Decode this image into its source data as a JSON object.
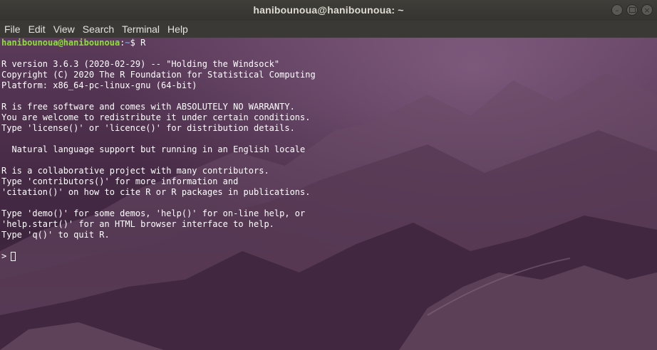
{
  "window": {
    "title": "hanibounoua@hanibounoua: ~"
  },
  "menu": [
    "File",
    "Edit",
    "View",
    "Search",
    "Terminal",
    "Help"
  ],
  "terminal": {
    "prompt": {
      "user_host": "hanibounoua@hanibounoua",
      "separator": ":",
      "path": "~",
      "symbol": "$ ",
      "command": "R"
    },
    "lines": [
      "",
      "R version 3.6.3 (2020-02-29) -- \"Holding the Windsock\"",
      "Copyright (C) 2020 The R Foundation for Statistical Computing",
      "Platform: x86_64-pc-linux-gnu (64-bit)",
      "",
      "R is free software and comes with ABSOLUTELY NO WARRANTY.",
      "You are welcome to redistribute it under certain conditions.",
      "Type 'license()' or 'licence()' for distribution details.",
      "",
      "  Natural language support but running in an English locale",
      "",
      "R is a collaborative project with many contributors.",
      "Type 'contributors()' for more information and",
      "'citation()' on how to cite R or R packages in publications.",
      "",
      "Type 'demo()' for some demos, 'help()' for on-line help, or",
      "'help.start()' for an HTML browser interface to help.",
      "Type 'q()' to quit R.",
      ""
    ],
    "r_prompt": ">"
  },
  "colors": {
    "prompt_user": "#8ae234",
    "prompt_path": "#729fcf",
    "text": "#ffffff"
  }
}
